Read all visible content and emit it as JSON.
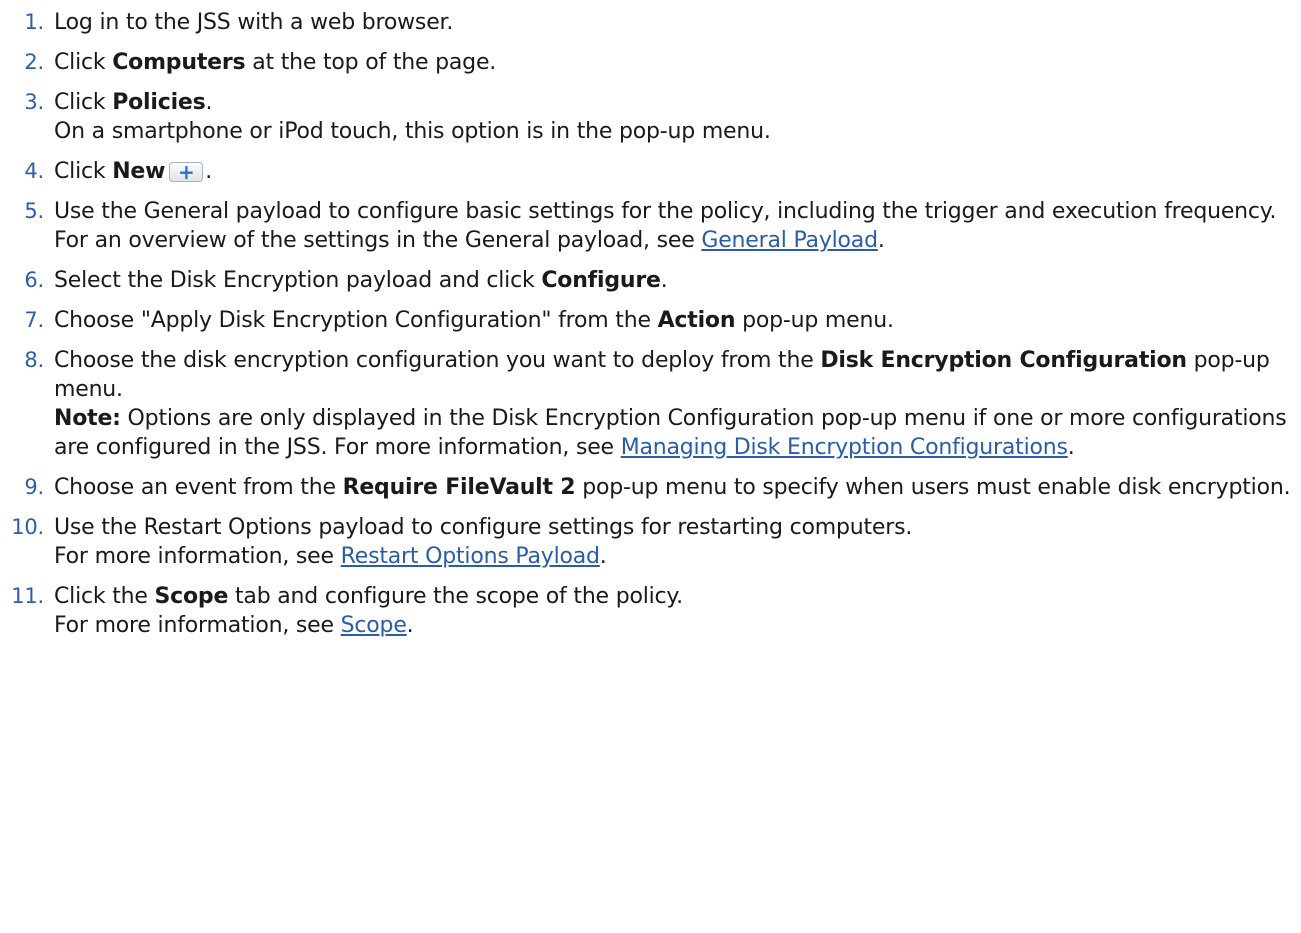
{
  "steps": [
    {
      "num": "1.",
      "text": "Log in to the JSS with a web browser."
    },
    {
      "num": "2.",
      "pre": "Click ",
      "bold": "Computers",
      "post": " at the top of the page."
    },
    {
      "num": "3.",
      "pre": "Click ",
      "bold": "Policies",
      "post": ".",
      "sub": "On a smartphone or iPod touch, this option is in the pop-up menu."
    },
    {
      "num": "4.",
      "pre": "Click ",
      "bold": "New",
      "post": ".",
      "icon": "plus-button-icon"
    },
    {
      "num": "5.",
      "text": "Use the General payload to configure basic settings for the policy, including the trigger and execution frequency.",
      "sub_pre": "For an overview of the settings in the General payload, see ",
      "sub_link": "General Payload",
      "sub_post": "."
    },
    {
      "num": "6.",
      "pre": "Select the Disk Encryption payload and click ",
      "bold": "Configure",
      "post": "."
    },
    {
      "num": "7.",
      "pre": "Choose \"Apply Disk Encryption Configuration\" from the ",
      "bold": "Action",
      "post": " pop-up menu."
    },
    {
      "num": "8.",
      "pre": "Choose the disk encryption configuration you want to deploy from the ",
      "bold": "Disk Encryption Configuration",
      "post": " pop-up menu.",
      "note_label": "Note:",
      "note_pre": " Options are only displayed in the Disk Encryption Configuration pop-up menu if one or more configurations are configured in the JSS. For more information, see ",
      "note_link": "Managing Disk Encryption Configurations",
      "note_post": "."
    },
    {
      "num": "9.",
      "pre": "Choose an event from the ",
      "bold": "Require FileVault 2",
      "post": " pop-up menu to specify when users must enable disk encryption."
    },
    {
      "num": "10.",
      "text": "Use the Restart Options payload to configure settings for restarting computers.",
      "sub_pre": "For more information, see ",
      "sub_link": "Restart Options Payload",
      "sub_post": "."
    },
    {
      "num": "11.",
      "pre": "Click the ",
      "bold": "Scope",
      "post": " tab and configure the scope of the policy.",
      "sub_pre": "For more information, see ",
      "sub_link": "Scope",
      "sub_post": "."
    }
  ]
}
